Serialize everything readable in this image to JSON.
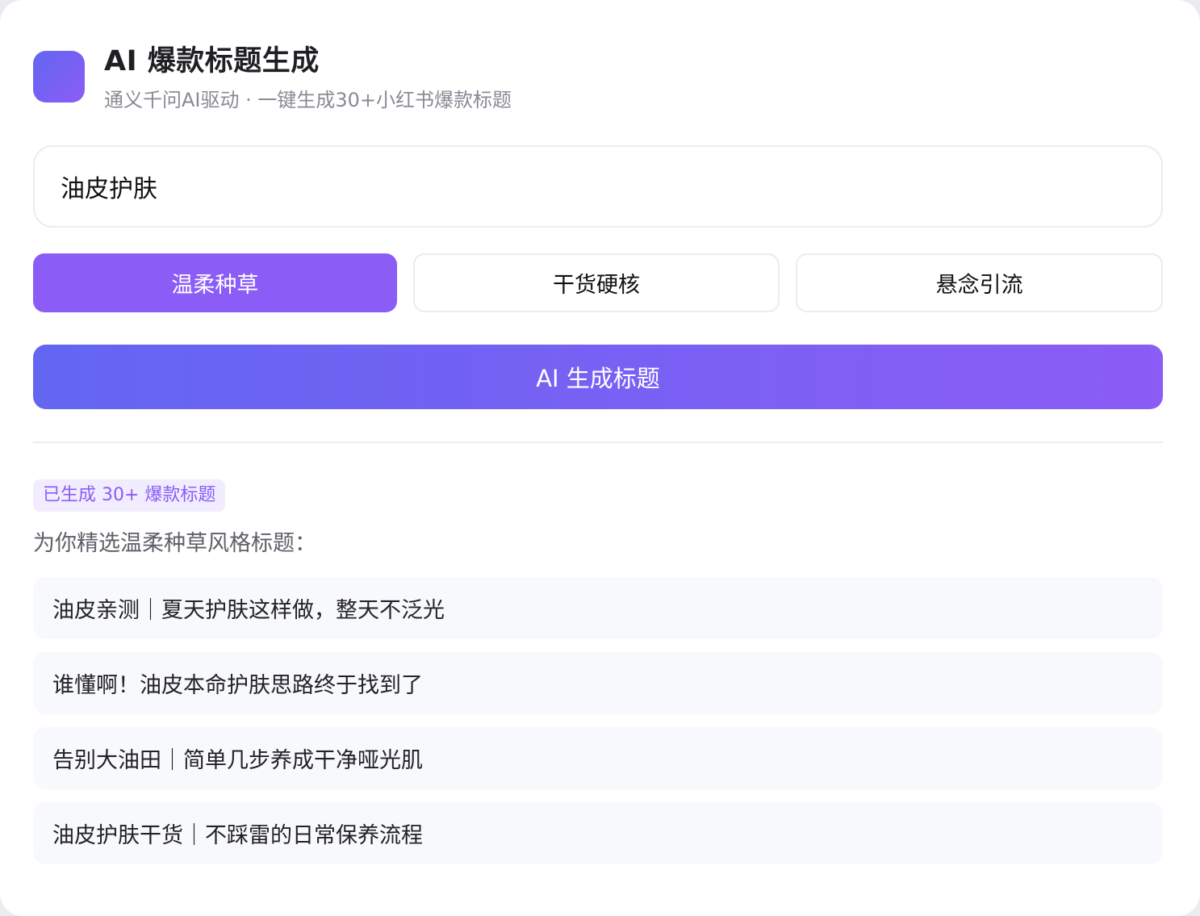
{
  "header": {
    "title": "AI 爆款标题生成",
    "subtitle": "通义千问AI驱动 · 一键生成30+小红书爆款标题",
    "logo_colors": [
      "#6366f1",
      "#8b5cf6"
    ]
  },
  "keyword_input": {
    "value": "油皮护肤"
  },
  "styles": [
    {
      "label": "温柔种草",
      "active": true
    },
    {
      "label": "干货硬核",
      "active": false
    },
    {
      "label": "悬念引流",
      "active": false
    }
  ],
  "generate_button": {
    "label": "AI 生成标题"
  },
  "result": {
    "badge": "已生成 30+ 爆款标题",
    "section_title": "为你精选温柔种草风格标题：",
    "items": [
      "油皮亲测｜夏天护肤这样做，整天不泛光",
      "谁懂啊！油皮本命护肤思路终于找到了",
      "告别大油田｜简单几步养成干净哑光肌",
      "油皮护肤干货｜不踩雷的日常保养流程"
    ]
  },
  "colors": {
    "accent": "#8b5cf6",
    "accent_start": "#6366f1",
    "badge_bg": "#f1edff",
    "item_bg": "#f8f9fd"
  }
}
